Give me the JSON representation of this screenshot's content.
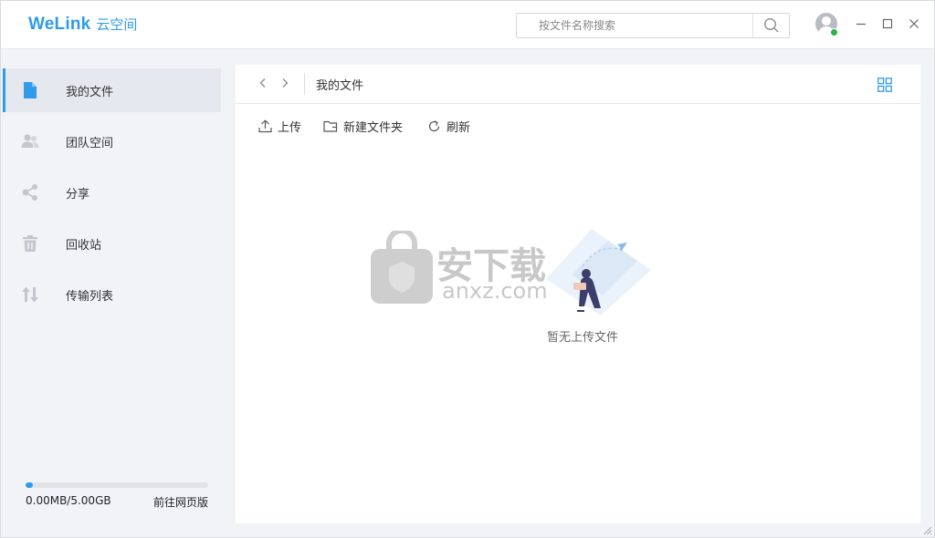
{
  "app": {
    "brand": "WeLink",
    "product": "云空间"
  },
  "search": {
    "placeholder": "按文件名称搜索"
  },
  "window_controls": [
    "minimize-icon",
    "maximize-icon",
    "close-icon"
  ],
  "sidebar": {
    "items": [
      {
        "label": "我的文件",
        "icon": "file-icon",
        "active": true
      },
      {
        "label": "团队空间",
        "icon": "team-icon",
        "active": false
      },
      {
        "label": "分享",
        "icon": "share-icon",
        "active": false
      },
      {
        "label": "回收站",
        "icon": "trash-icon",
        "active": false
      },
      {
        "label": "传输列表",
        "icon": "transfer-icon",
        "active": false
      }
    ],
    "quota": {
      "used_text": "0.00MB/5.00GB",
      "progress_fraction": 0.04,
      "web_link": "前往网页版"
    }
  },
  "main": {
    "breadcrumb": "我的文件",
    "toolbar": {
      "upload": "上传",
      "new_folder": "新建文件夹",
      "refresh": "刷新"
    },
    "empty_text": "暂无上传文件"
  },
  "watermark": {
    "title": "安下载",
    "domain": "anxz.com",
    "icon": "shield-lock-icon"
  },
  "colors": {
    "accent": "#2f9bea",
    "active_bg": "#e6e8ef",
    "nav_icon": "#c3c6cd",
    "online": "#2bb24c"
  }
}
